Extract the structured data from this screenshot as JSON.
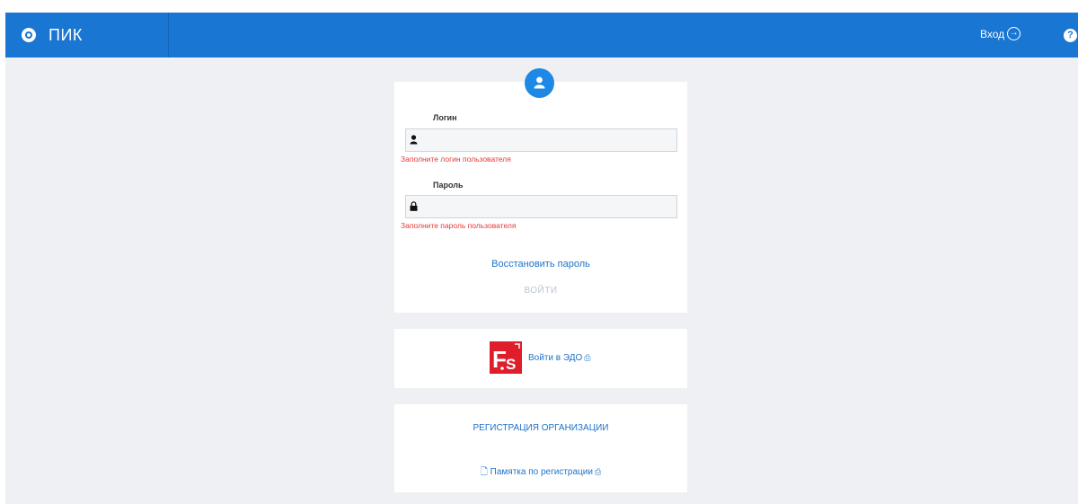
{
  "header": {
    "brand_title": "ПИК",
    "login_label": "Вход",
    "login_arrow_glyph": "→",
    "help_glyph": "?"
  },
  "login_form": {
    "login_label": "Логин",
    "login_value": "",
    "login_error": "Заполните логин пользователя",
    "password_label": "Пароль",
    "password_value": "",
    "password_error": "Заполните пароль пользователя",
    "restore_link": "Восстановить пароль",
    "submit_label": "ВОЙТИ"
  },
  "edo": {
    "link_label": "Войти в ЭДО",
    "external_glyph": "⎙"
  },
  "registration": {
    "register_label": "РЕГИСТРАЦИЯ ОРГАНИЗАЦИИ",
    "memo_label": "Памятка по регистрации",
    "memo_glyph": "🗋",
    "external_glyph": "⎙"
  },
  "colors": {
    "header_bg": "#1976d2",
    "page_bg": "#eef0f3",
    "link": "#1e73c9",
    "error": "#e53935",
    "edo_logo": "#e01e2b",
    "disabled_button": "#b9c4d6"
  },
  "icons": {
    "brand": "logo-ring-icon",
    "login": "sign-in-arrow-icon",
    "help": "question-circle-icon",
    "avatar": "user-avatar-icon",
    "login_field": "user-icon",
    "password_field": "lock-icon",
    "edo": "edo-logo",
    "external": "external-link-icon",
    "memo": "document-icon"
  }
}
